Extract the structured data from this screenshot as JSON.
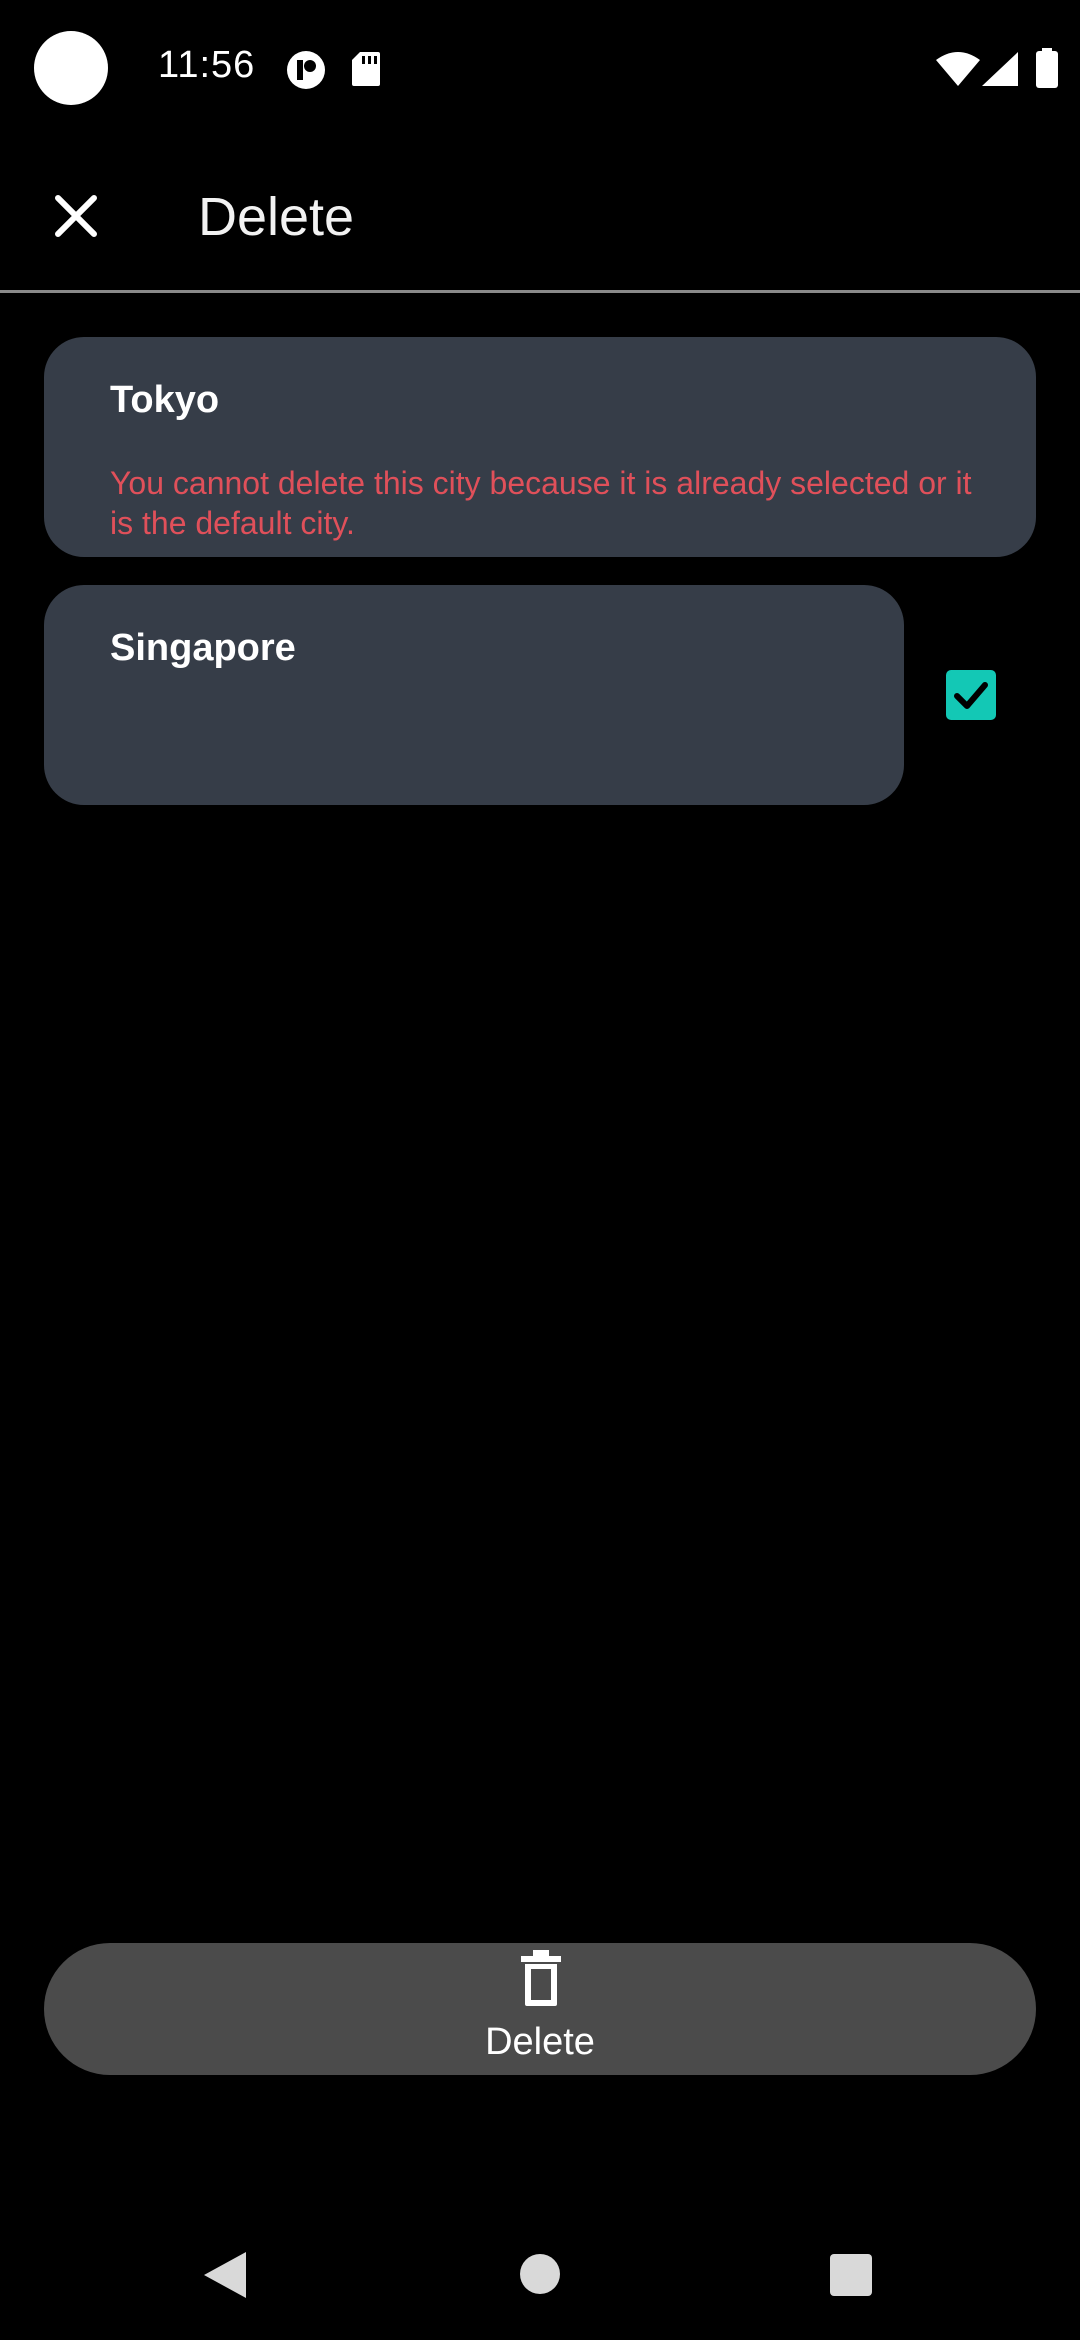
{
  "status_bar": {
    "time": "11:56",
    "icons": [
      "camera-dot-icon",
      "profile-app-icon",
      "sd-card-icon",
      "wifi-icon",
      "signal-icon",
      "battery-icon"
    ]
  },
  "app_bar": {
    "title": "Delete",
    "close_icon": "close-icon"
  },
  "cities": [
    {
      "name": "Tokyo",
      "message": "You cannot delete this city because it is already selected or it is the default city.",
      "selectable": false
    },
    {
      "name": "Singapore",
      "message": "",
      "selectable": true,
      "checked": true
    }
  ],
  "action": {
    "delete_label": "Delete",
    "icon": "trash-icon"
  },
  "nav": {
    "back": "back-icon",
    "home": "home-icon",
    "recents": "recents-icon"
  },
  "colors": {
    "background": "#000000",
    "card": "#363d48",
    "error_text": "#e0505a",
    "accent": "#13c8b5",
    "button": "#4b4b4b"
  }
}
